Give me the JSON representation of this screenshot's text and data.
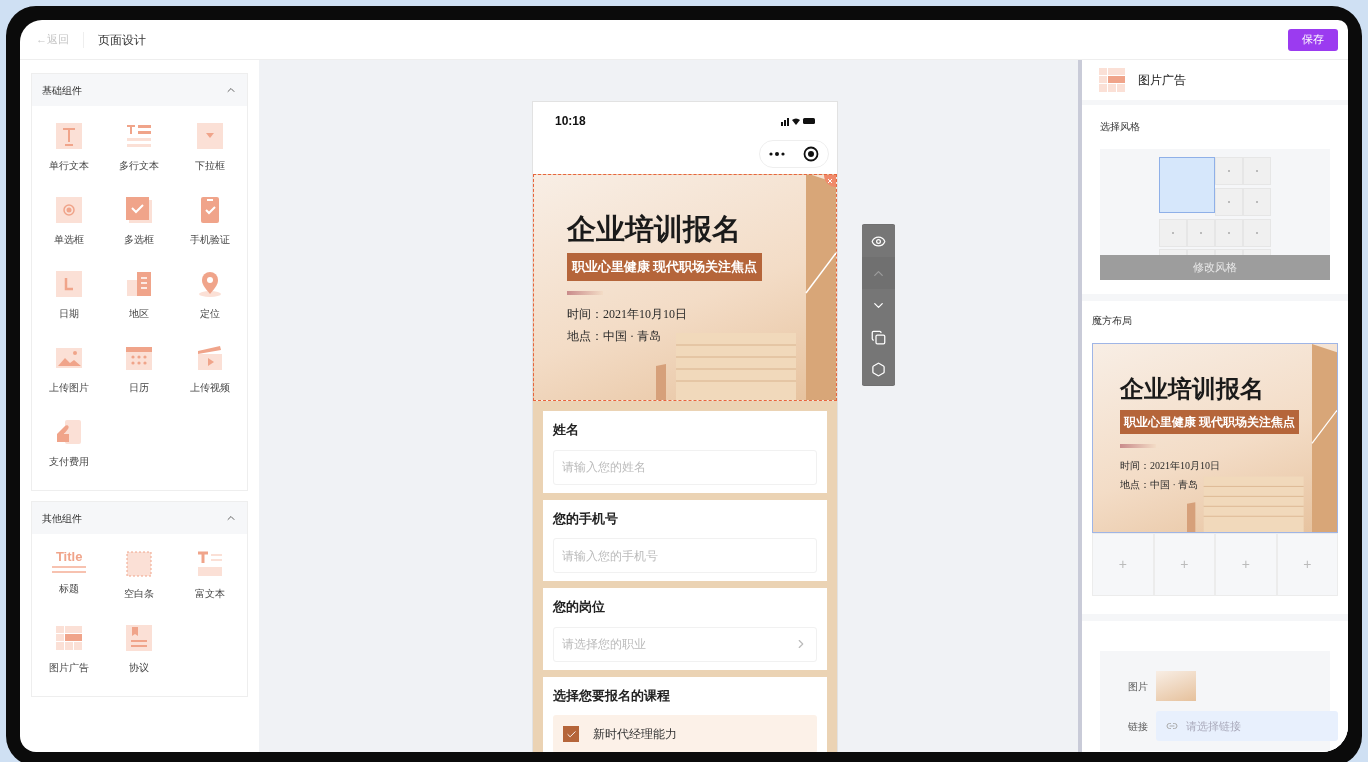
{
  "topbar": {
    "back": "←返回",
    "title": "页面设计",
    "save": "保存"
  },
  "component_groups": [
    {
      "title": "基础组件",
      "expanded": true,
      "items": [
        {
          "label": "单行文本",
          "kind": "text"
        },
        {
          "label": "多行文本",
          "kind": "textarea"
        },
        {
          "label": "下拉框",
          "kind": "dropdown"
        },
        {
          "label": "单选框",
          "kind": "radio"
        },
        {
          "label": "多选框",
          "kind": "checkbox"
        },
        {
          "label": "手机验证",
          "kind": "phone"
        },
        {
          "label": "日期",
          "kind": "date"
        },
        {
          "label": "地区",
          "kind": "region"
        },
        {
          "label": "定位",
          "kind": "location"
        },
        {
          "label": "上传图片",
          "kind": "image"
        },
        {
          "label": "日历",
          "kind": "calendar"
        },
        {
          "label": "上传视频",
          "kind": "video"
        },
        {
          "label": "支付费用",
          "kind": "payment"
        }
      ]
    },
    {
      "title": "其他组件",
      "expanded": true,
      "items": [
        {
          "label": "标题",
          "kind": "heading",
          "glyph": "Title"
        },
        {
          "label": "空白条",
          "kind": "blank"
        },
        {
          "label": "富文本",
          "kind": "richtext"
        },
        {
          "label": "图片广告",
          "kind": "imagead"
        },
        {
          "label": "协议",
          "kind": "agreement"
        }
      ]
    }
  ],
  "phone": {
    "time": "10:18",
    "banner": {
      "title": "企业培训报名",
      "subtitle": "职业心里健康 现代职场关注焦点",
      "time": "时间：2021年10月10日",
      "place": "地点：中国 · 青岛",
      "selected": true
    },
    "fields": [
      {
        "kind": "input",
        "label": "姓名",
        "placeholder": "请输入您的姓名"
      },
      {
        "kind": "input",
        "label": "您的手机号",
        "placeholder": "请输入您的手机号"
      },
      {
        "kind": "select",
        "label": "您的岗位",
        "placeholder": "请选择您的职业"
      },
      {
        "kind": "checkbox",
        "label": "选择您要报名的课程",
        "options": [
          {
            "label": "新时代经理能力",
            "checked": true
          }
        ]
      }
    ]
  },
  "toolbar": [
    {
      "kind": "eye",
      "disabled": false
    },
    {
      "kind": "up",
      "disabled": true
    },
    {
      "kind": "down",
      "disabled": false
    },
    {
      "kind": "copy",
      "disabled": false
    },
    {
      "kind": "settings",
      "disabled": false
    }
  ],
  "right_panel": {
    "title": "图片广告",
    "style_section": {
      "label": "选择风格",
      "button": "修改风格"
    },
    "layout_section": {
      "label": "魔方布局",
      "banner": {
        "title": "企业培训报名",
        "subtitle": "职业心里健康 现代职场关注焦点",
        "time": "时间：2021年10月10日",
        "place": "地点：中国 · 青岛"
      },
      "slots": [
        "+",
        "+",
        "+",
        "+"
      ]
    },
    "item": {
      "image_label": "图片",
      "link_label": "链接",
      "link_placeholder": "请选择链接"
    }
  }
}
